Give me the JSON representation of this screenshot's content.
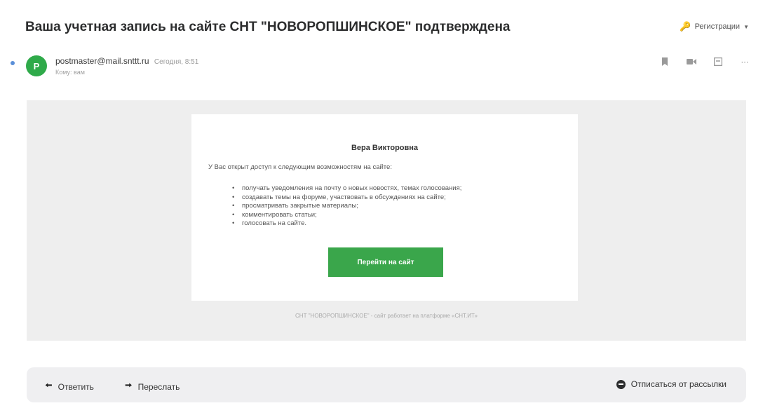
{
  "message": {
    "subject": "Ваша учетная запись на сайте СНТ \"НОВОРОПШИНСКОЕ\" подтверждена",
    "folder_label": "Регистрации",
    "sender_email": "postmaster@mail.snttt.ru",
    "date": "Сегодня, 8:51",
    "recipient": "Кому: вам",
    "avatar_letter": "P"
  },
  "body": {
    "greeting": "Вера Викторовна",
    "intro": "У Вас открыт доступ к следующим возможностям на сайте:",
    "items": [
      "получать уведомления на почту о новых новостях, темах голосования;",
      "создавать темы на форуме, участвовать в обсуждениях на сайте;",
      "просматривать закрытые материалы;",
      "комментировать статьи;",
      "голосовать на сайте."
    ],
    "button_label": "Перейти на сайт",
    "footer_note": "СНТ \"НОВОРОПШИНСКОЕ\" - сайт работает на платформе «СНТ.ИТ»"
  },
  "reply_bar": {
    "reply_label": "Ответить",
    "forward_label": "Переслать",
    "unsubscribe_label": "Отписаться от рассылки"
  },
  "icons": {
    "folder": "key-icon",
    "actions": [
      "bookmark-icon",
      "video-icon",
      "archive-icon",
      "more-icon"
    ],
    "reply": "reply-arrow-icon",
    "forward": "forward-arrow-icon",
    "unsubscribe": "minus-circle-icon"
  },
  "colors": {
    "accent_green": "#3aa64b",
    "avatar_green": "#2faa4a",
    "folder_key": "#f2a20a"
  }
}
